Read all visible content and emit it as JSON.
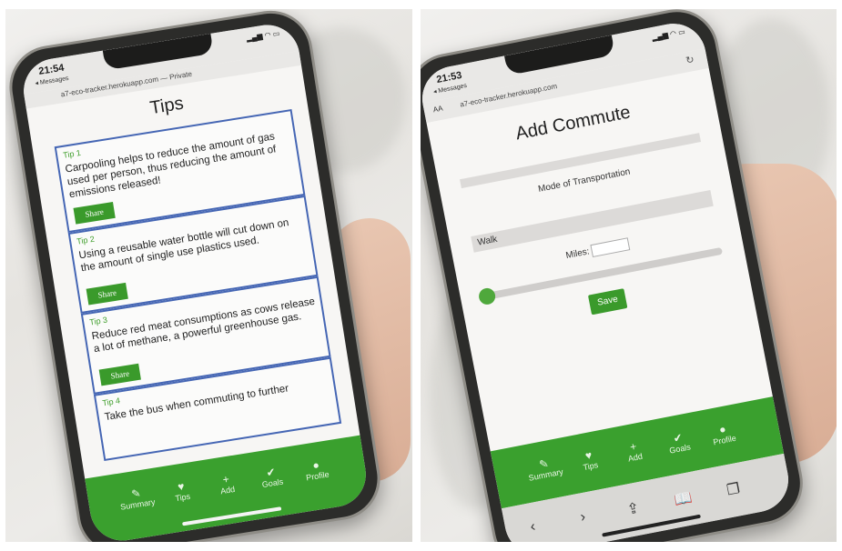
{
  "left_phone": {
    "status": {
      "time": "21:54",
      "back_label": "◂ Messages",
      "signal": "▂▄▆ ◠ ▭"
    },
    "url": "a7-eco-tracker.herokuapp.com — Private",
    "title": "Tips",
    "tips": [
      {
        "label": "Tip 1",
        "text": "Carpooling helps to reduce the amount of gas used per person, thus reducing the amount of emissions released!",
        "button": "Share"
      },
      {
        "label": "Tip 2",
        "text": "Using a reusable water bottle will cut down on the amount of single use plastics used.",
        "button": "Share"
      },
      {
        "label": "Tip 3",
        "text": "Reduce red meat consumptions as cows release a lot of methane, a powerful greenhouse gas.",
        "button": "Share"
      },
      {
        "label": "Tip 4",
        "text": "Take the bus when commuting to further",
        "button": ""
      }
    ],
    "nav": [
      {
        "icon": "✎",
        "label": "Summary"
      },
      {
        "icon": "♥",
        "label": "Tips"
      },
      {
        "icon": "+",
        "label": "Add"
      },
      {
        "icon": "✔",
        "label": "Goals"
      },
      {
        "icon": "●",
        "label": "Profile"
      }
    ]
  },
  "right_phone": {
    "status": {
      "time": "21:53",
      "back_label": "◂ Messages",
      "signal": "▂▄▆ ◠ ▭"
    },
    "address_bar": {
      "aa": "AA",
      "url": "a7-eco-tracker.herokuapp.com",
      "reload": "↻"
    },
    "title": "Add Commute",
    "mode_label": "Mode of Transportation",
    "mode_value": "Walk",
    "miles_label": "Miles:",
    "miles_value": "",
    "slider_value": 0,
    "save_label": "Save",
    "nav": [
      {
        "icon": "✎",
        "label": "Summary"
      },
      {
        "icon": "♥",
        "label": "Tips"
      },
      {
        "icon": "+",
        "label": "Add"
      },
      {
        "icon": "✔",
        "label": "Goals"
      },
      {
        "icon": "●",
        "label": "Profile"
      }
    ],
    "safari_toolbar": [
      "‹",
      "›",
      "⇪",
      "📖",
      "❐"
    ]
  },
  "colors": {
    "accent_green": "#3aa02e",
    "card_border": "#4566b4",
    "tip_label": "#3f9e2b"
  }
}
